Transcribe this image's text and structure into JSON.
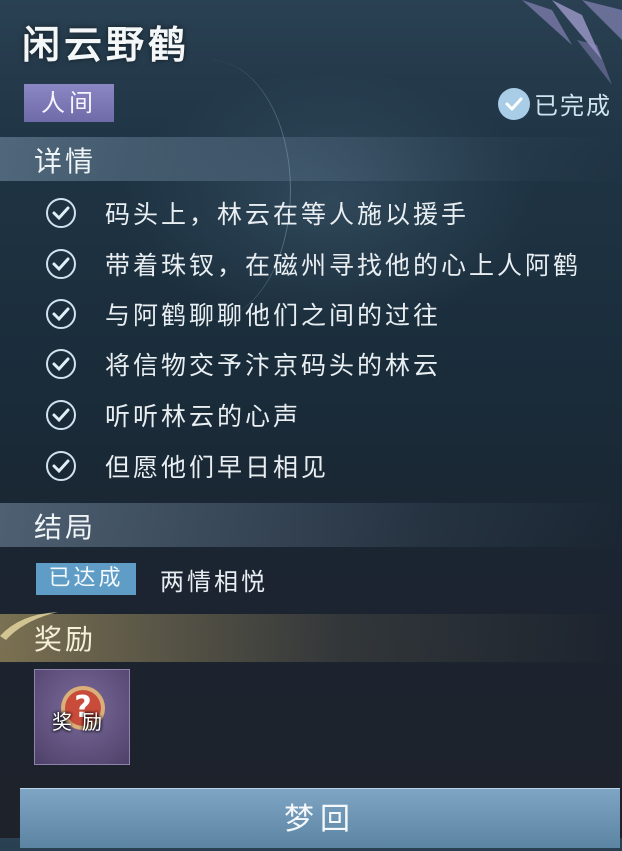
{
  "quest": {
    "title": "闲云野鹤",
    "realm_tag": "人间",
    "status": "已完成"
  },
  "details": {
    "heading": "详情",
    "items": [
      "码头上，林云在等人施以援手",
      "带着珠钗，在磁州寻找他的心上人阿鹤",
      "与阿鹤聊聊他们之间的过往",
      "将信物交予汴京码头的林云",
      "听听林云的心声",
      "但愿他们早日相见"
    ]
  },
  "ending": {
    "heading": "结局",
    "badge": "已达成",
    "text": "两情相悦"
  },
  "reward": {
    "heading": "奖励",
    "item_label": "奖励",
    "item_icon": "question-mark-icon"
  },
  "actions": {
    "dream_button": "梦回"
  },
  "colors": {
    "accent_blue": "#5f9cc6",
    "realm_tag": "#8b86c4",
    "reward_gold": "#c8af6e"
  }
}
